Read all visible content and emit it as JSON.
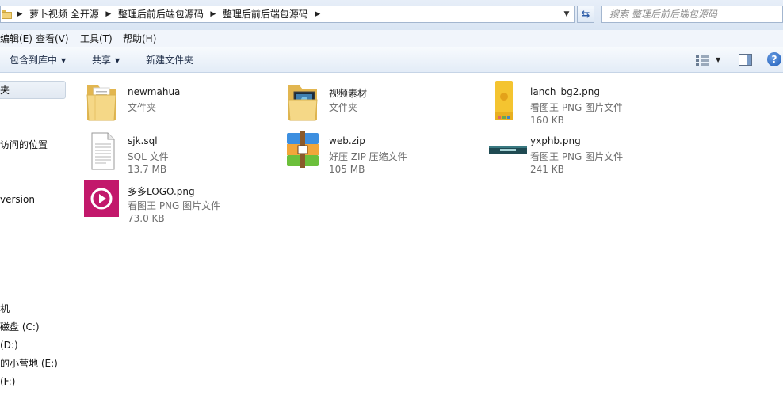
{
  "breadcrumb": {
    "items": [
      "萝卜视频 全开源",
      "整理后前后端包源码",
      "整理后前后端包源码"
    ]
  },
  "search": {
    "placeholder": "搜索 整理后前后端包源码"
  },
  "menu": {
    "items": [
      "编辑(E)",
      "查看(V)",
      "工具(T)",
      "帮助(H)"
    ]
  },
  "toolbar": {
    "include_library": "包含到库中",
    "share": "共享",
    "new_folder": "新建文件夹"
  },
  "nav": {
    "items": [
      "夹",
      "",
      "",
      "访问的位置",
      "",
      "",
      "version",
      "",
      "",
      "",
      "",
      "",
      "",
      "机",
      "磁盘 (C:)",
      "(D:)",
      "的小营地 (E:)",
      "(F:)"
    ]
  },
  "files": [
    {
      "name": "newmahua",
      "type": "文件夹",
      "size": "",
      "icon": "folder-icon"
    },
    {
      "name": "视频素材",
      "type": "文件夹",
      "size": "",
      "icon": "folder-video-icon"
    },
    {
      "name": "lanch_bg2.png",
      "type": "看图王 PNG 图片文件",
      "size": "160 KB",
      "icon": "image-thumbnail"
    },
    {
      "name": "sjk.sql",
      "type": "SQL 文件",
      "size": "13.7 MB",
      "icon": "text-file-icon"
    },
    {
      "name": "web.zip",
      "type": "好压 ZIP 压缩文件",
      "size": "105 MB",
      "icon": "zip-archive-icon"
    },
    {
      "name": "yxphb.png",
      "type": "看图王 PNG 图片文件",
      "size": "241 KB",
      "icon": "image-thumbnail"
    },
    {
      "name": "多多LOGO.png",
      "type": "看图王 PNG 图片文件",
      "size": "73.0 KB",
      "icon": "image-thumbnail"
    }
  ],
  "colors": {
    "toolbar_bg": "#e3ecf7",
    "selection": "#e2e9f2",
    "text_secondary": "#6d6d6d",
    "logo_magenta": "#c2186b"
  }
}
